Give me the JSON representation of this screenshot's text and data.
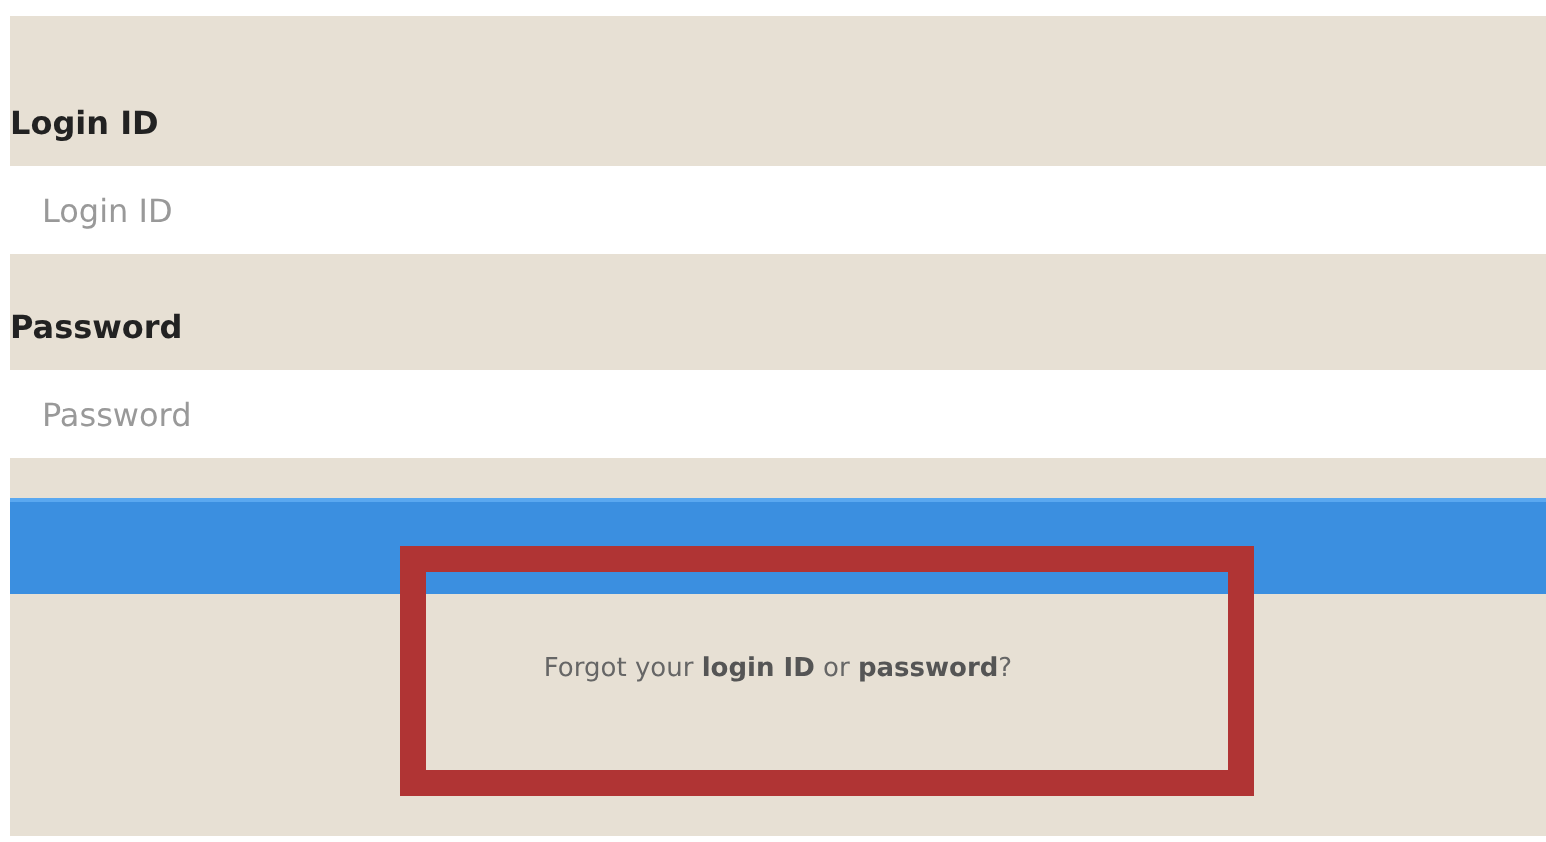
{
  "fields": [
    {
      "label": "Login ID",
      "placeholder": "Login ID"
    },
    {
      "label": "Password",
      "placeholder": "Password"
    }
  ],
  "forgot": [
    {
      "kind": "plain",
      "text": "Forgot your "
    },
    {
      "kind": "link",
      "text": "login ID"
    },
    {
      "kind": "plain",
      "text": " or "
    },
    {
      "kind": "link",
      "text": "password"
    },
    {
      "kind": "plain",
      "text": "?"
    }
  ]
}
